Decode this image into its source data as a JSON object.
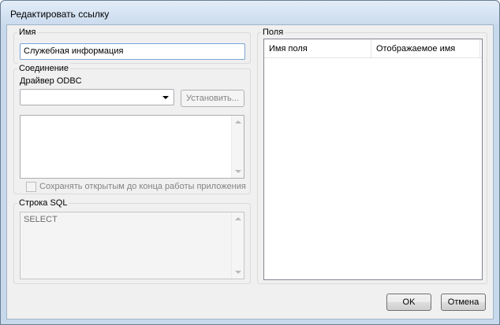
{
  "window": {
    "title": "Редактировать ссылку"
  },
  "name_group": {
    "label": "Имя",
    "value": "Служебная информация"
  },
  "connection_group": {
    "label": "Соединение",
    "driver_label": "Драйвер ODBC",
    "driver_value": "",
    "install_button": "Установить...",
    "connection_text": "",
    "keep_open_label": "Сохранять открытым до конца работы приложения",
    "keep_open_checked": false
  },
  "sql_group": {
    "label": "Строка SQL",
    "value": "SELECT"
  },
  "fields_group": {
    "label": "Поля",
    "columns": [
      "Имя поля",
      "Отображаемое имя"
    ],
    "rows": []
  },
  "buttons": {
    "ok": "OK",
    "cancel": "Отмена"
  }
}
